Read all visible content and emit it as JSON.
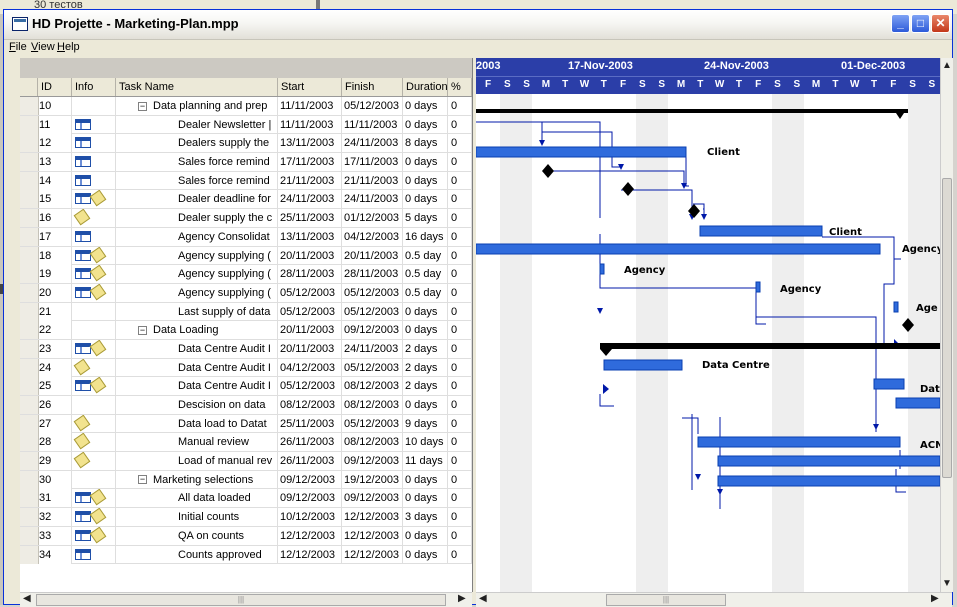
{
  "background": {
    "window_text": "30 тестов"
  },
  "window": {
    "title": "HD Projette - Marketing-Plan.mpp"
  },
  "menu": [
    "File",
    "View",
    "Help"
  ],
  "columns": {
    "id": "ID",
    "info": "Info",
    "name": "Task Name",
    "start": "Start",
    "finish": "Finish",
    "duration": "Duration",
    "pct": "%"
  },
  "tasks": [
    {
      "id": "10",
      "icons": [],
      "summary": true,
      "name": "Data planning and prep",
      "start": "11/11/2003",
      "finish": "05/12/2003",
      "duration": "0 days",
      "pct": "0"
    },
    {
      "id": "11",
      "icons": [
        "table"
      ],
      "name": "Dealer Newsletter | ",
      "start": "11/11/2003",
      "finish": "11/11/2003",
      "duration": "0 days",
      "pct": "0"
    },
    {
      "id": "12",
      "icons": [
        "table"
      ],
      "name": "Dealers supply the",
      "start": "13/11/2003",
      "finish": "24/11/2003",
      "duration": "8 days",
      "pct": "0"
    },
    {
      "id": "13",
      "icons": [
        "table"
      ],
      "name": "Sales force remind",
      "start": "17/11/2003",
      "finish": "17/11/2003",
      "duration": "0 days",
      "pct": "0"
    },
    {
      "id": "14",
      "icons": [
        "table"
      ],
      "name": "Sales force remind",
      "start": "21/11/2003",
      "finish": "21/11/2003",
      "duration": "0 days",
      "pct": "0"
    },
    {
      "id": "15",
      "icons": [
        "table",
        "note"
      ],
      "name": "Dealer deadline for",
      "start": "24/11/2003",
      "finish": "24/11/2003",
      "duration": "0 days",
      "pct": "0"
    },
    {
      "id": "16",
      "icons": [
        "note"
      ],
      "name": "Dealer supply the c",
      "start": "25/11/2003",
      "finish": "01/12/2003",
      "duration": "5 days",
      "pct": "0"
    },
    {
      "id": "17",
      "icons": [
        "table"
      ],
      "name": "Agency Consolidat",
      "start": "13/11/2003",
      "finish": "04/12/2003",
      "duration": "16 days",
      "pct": "0"
    },
    {
      "id": "18",
      "icons": [
        "table",
        "note"
      ],
      "name": "Agency supplying (",
      "start": "20/11/2003",
      "finish": "20/11/2003",
      "duration": "0.5 day",
      "pct": "0"
    },
    {
      "id": "19",
      "icons": [
        "table",
        "note"
      ],
      "name": "Agency supplying (",
      "start": "28/11/2003",
      "finish": "28/11/2003",
      "duration": "0.5 day",
      "pct": "0"
    },
    {
      "id": "20",
      "icons": [
        "table",
        "note"
      ],
      "name": "Agency supplying (",
      "start": "05/12/2003",
      "finish": "05/12/2003",
      "duration": "0.5 day",
      "pct": "0"
    },
    {
      "id": "21",
      "icons": [],
      "name": "Last supply of data",
      "start": "05/12/2003",
      "finish": "05/12/2003",
      "duration": "0 days",
      "pct": "0"
    },
    {
      "id": "22",
      "icons": [],
      "summary": true,
      "name": "Data Loading",
      "start": "20/11/2003",
      "finish": "09/12/2003",
      "duration": "0 days",
      "pct": "0"
    },
    {
      "id": "23",
      "icons": [
        "table",
        "note"
      ],
      "name": "Data Centre Audit I",
      "start": "20/11/2003",
      "finish": "24/11/2003",
      "duration": "2 days",
      "pct": "0"
    },
    {
      "id": "24",
      "icons": [
        "note"
      ],
      "name": "Data Centre Audit I",
      "start": "04/12/2003",
      "finish": "05/12/2003",
      "duration": "2 days",
      "pct": "0"
    },
    {
      "id": "25",
      "icons": [
        "table",
        "note"
      ],
      "name": "Data Centre Audit I",
      "start": "05/12/2003",
      "finish": "08/12/2003",
      "duration": "2 days",
      "pct": "0"
    },
    {
      "id": "26",
      "icons": [],
      "name": "Descision on data",
      "start": "08/12/2003",
      "finish": "08/12/2003",
      "duration": "0 days",
      "pct": "0"
    },
    {
      "id": "27",
      "icons": [
        "note"
      ],
      "name": "Data load to Datat",
      "start": "25/11/2003",
      "finish": "05/12/2003",
      "duration": "9 days",
      "pct": "0"
    },
    {
      "id": "28",
      "icons": [
        "note"
      ],
      "name": "Manual review",
      "start": "26/11/2003",
      "finish": "08/12/2003",
      "duration": "10 days",
      "pct": "0"
    },
    {
      "id": "29",
      "icons": [
        "note"
      ],
      "name": "Load of manual rev",
      "start": "26/11/2003",
      "finish": "09/12/2003",
      "duration": "11 days",
      "pct": "0"
    },
    {
      "id": "30",
      "icons": [],
      "summary": true,
      "name": "Marketing selections",
      "start": "09/12/2003",
      "finish": "19/12/2003",
      "duration": "0 days",
      "pct": "0"
    },
    {
      "id": "31",
      "icons": [
        "table",
        "note"
      ],
      "name": "All data loaded",
      "start": "09/12/2003",
      "finish": "09/12/2003",
      "duration": "0 days",
      "pct": "0"
    },
    {
      "id": "32",
      "icons": [
        "table",
        "note"
      ],
      "name": "Initial counts",
      "start": "10/12/2003",
      "finish": "12/12/2003",
      "duration": "3 days",
      "pct": "0"
    },
    {
      "id": "33",
      "icons": [
        "table",
        "note"
      ],
      "name": "QA on counts",
      "start": "12/12/2003",
      "finish": "12/12/2003",
      "duration": "0 days",
      "pct": "0"
    },
    {
      "id": "34",
      "icons": [
        "table"
      ],
      "name": "Counts approved",
      "start": "12/12/2003",
      "finish": "12/12/2003",
      "duration": "0 days",
      "pct": "0"
    }
  ],
  "timeline": {
    "weeks": [
      "2003",
      "17-Nov-2003",
      "24-Nov-2003",
      "01-Dec-2003"
    ],
    "days": [
      "F",
      "S",
      "S",
      "M",
      "T",
      "W",
      "T",
      "F",
      "S",
      "S",
      "M",
      "T",
      "W",
      "T",
      "F",
      "S",
      "S",
      "M",
      "T",
      "W",
      "T",
      "F",
      "S",
      "S"
    ],
    "bar_labels": {
      "client1": "Client",
      "client2": "Client",
      "agency1": "Agency",
      "agency2": "Agency",
      "agency3": "Agency",
      "agency4": "Age",
      "datacentre": "Data Centre",
      "dat": "Dat",
      "acn": "ACN"
    }
  },
  "colors": {
    "bar": "#2f6bdc",
    "timeline_bg": "#2b3ea8",
    "link": "#0018a8"
  }
}
